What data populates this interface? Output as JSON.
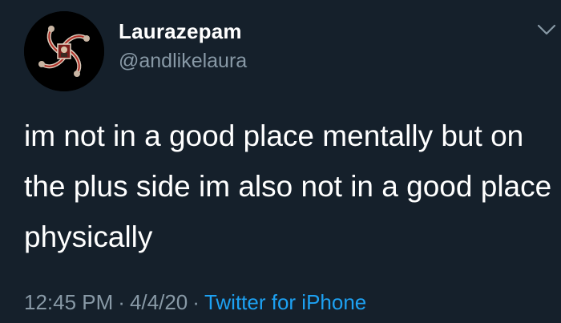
{
  "tweet": {
    "display_name": "Laurazepam",
    "handle": "@andlikelaura",
    "text": "im not in a good place mentally but on the plus side im also not in a good place physically",
    "time": "12:45 PM",
    "separator": "·",
    "date": "4/4/20",
    "source": "Twitter for iPhone"
  },
  "icons": {
    "avatar": "profile-avatar",
    "menu": "chevron-down-icon"
  },
  "colors": {
    "background": "#15202b",
    "text": "#ffffff",
    "secondary": "#8899a6",
    "link": "#1da1f2"
  }
}
